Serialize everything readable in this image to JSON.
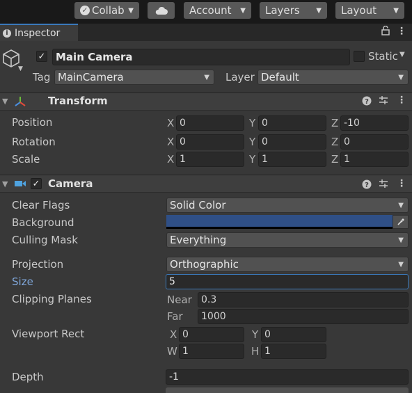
{
  "toolbar": {
    "collab_label": "Collab",
    "account_label": "Account",
    "layers_label": "Layers",
    "layout_label": "Layout"
  },
  "tab": {
    "label": "Inspector"
  },
  "gameobject": {
    "active": true,
    "name": "Main Camera",
    "static_label": "Static",
    "tag_label": "Tag",
    "tag_value": "MainCamera",
    "layer_label": "Layer",
    "layer_value": "Default"
  },
  "transform": {
    "title": "Transform",
    "rows": [
      {
        "label": "Position",
        "x": "0",
        "y": "0",
        "z": "-10"
      },
      {
        "label": "Rotation",
        "x": "0",
        "y": "0",
        "z": "0"
      },
      {
        "label": "Scale",
        "x": "1",
        "y": "1",
        "z": "1"
      }
    ],
    "axis_x": "X",
    "axis_y": "Y",
    "axis_z": "Z"
  },
  "camera": {
    "title": "Camera",
    "enabled": true,
    "clear_flags": {
      "label": "Clear Flags",
      "value": "Solid Color"
    },
    "background": {
      "label": "Background",
      "color": "#2f4f86"
    },
    "culling_mask": {
      "label": "Culling Mask",
      "value": "Everything"
    },
    "projection": {
      "label": "Projection",
      "value": "Orthographic"
    },
    "size": {
      "label": "Size",
      "value": "5"
    },
    "clipping": {
      "label": "Clipping Planes",
      "near_label": "Near",
      "near": "0.3",
      "far_label": "Far",
      "far": "1000"
    },
    "viewport": {
      "label": "Viewport Rect",
      "x_label": "X",
      "x": "0",
      "y_label": "Y",
      "y": "0",
      "w_label": "W",
      "w": "1",
      "h_label": "H",
      "h": "1"
    },
    "depth": {
      "label": "Depth",
      "value": "-1"
    }
  },
  "colors": {
    "accent": "#3a79bb",
    "size_label": "#7fa6d9"
  }
}
